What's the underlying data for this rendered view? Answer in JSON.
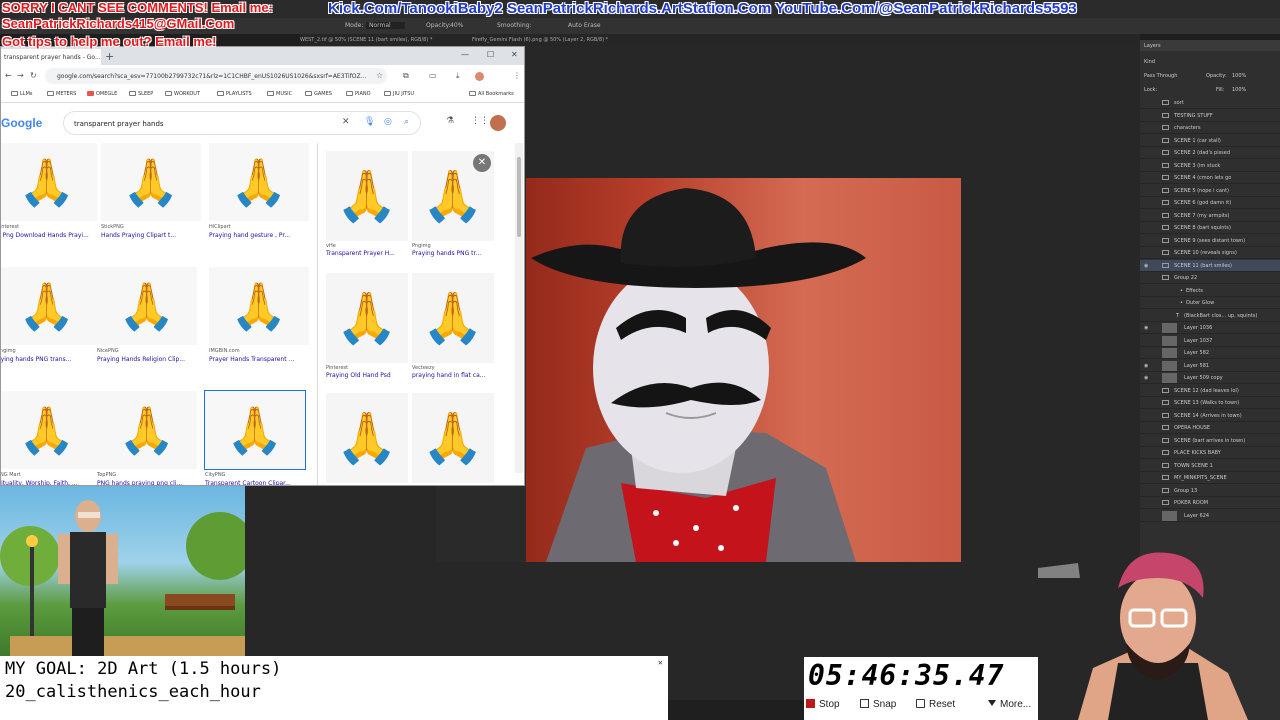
{
  "overlay": {
    "line1_red": "SORRY I CANT SEE COMMENTS! Email me:",
    "kick_link": "Kick.Com/TanookiBaby2",
    "artstation_link": "SeanPatrickRichards.ArtStation.Com",
    "youtube_link": "YouTube.Com/@SeanPatrickRichards5593",
    "email": "SeanPatrickRichards415@GMail.Com",
    "tips": "Got tips to help me out? Email me!"
  },
  "photoshop": {
    "options": {
      "mode_label": "Mode:",
      "mode_value": "Normal",
      "opacity_label": "Opacity:",
      "opacity_value": "40%",
      "smoothing_label": "Smoothing:",
      "auto_erase": "Auto Erase"
    },
    "tabs": [
      "WEST_2.tif @ 50% (SCENE 11 (bart smiles), RGB/8) *",
      "Firefly_Gemini Flash (6).png @ 50% (Layer 2, RGB/8) *"
    ],
    "layers_panel": {
      "title": "Layers",
      "filter_kind": "Kind",
      "blend_mode": "Pass Through",
      "opacity_label": "Opacity:",
      "opacity_value": "100%",
      "lock_label": "Lock:",
      "fill_label": "Fill:",
      "fill_value": "100%",
      "layers": [
        {
          "name": "sort",
          "type": "folder",
          "visible": false
        },
        {
          "name": "TESTING STUFF",
          "type": "folder",
          "visible": false
        },
        {
          "name": "characters",
          "type": "folder",
          "visible": false
        },
        {
          "name": "SCENE 1 (car stall)",
          "type": "folder",
          "visible": false
        },
        {
          "name": "SCENE 2 (dad's pissed",
          "type": "folder",
          "visible": false
        },
        {
          "name": "SCENE 3 (im stuck",
          "type": "folder",
          "visible": false
        },
        {
          "name": "SCENE 4 (cmon lets go",
          "type": "folder",
          "visible": false
        },
        {
          "name": "SCENE 5 (nope i cant)",
          "type": "folder",
          "visible": false
        },
        {
          "name": "SCENE 6 (god damn it)",
          "type": "folder",
          "visible": false
        },
        {
          "name": "SCENE 7 (my armpits)",
          "type": "folder",
          "visible": false
        },
        {
          "name": "SCENE 8 (bart squints)",
          "type": "folder",
          "visible": false
        },
        {
          "name": "SCENE 9 (sees distant town)",
          "type": "folder",
          "visible": false
        },
        {
          "name": "SCENE 10 (reveals signs)",
          "type": "folder",
          "visible": false
        },
        {
          "name": "SCENE 11 (bart smiles)",
          "type": "folder",
          "visible": true,
          "selected": true
        },
        {
          "name": "Group 22",
          "type": "folder",
          "visible": false
        },
        {
          "name": "Effects",
          "type": "fx",
          "visible": false
        },
        {
          "name": "Outer Glow",
          "type": "fx",
          "visible": false
        },
        {
          "name": "(BlackBart clos... up, squints)",
          "type": "text",
          "visible": false
        },
        {
          "name": "Layer 1036",
          "type": "image",
          "visible": true
        },
        {
          "name": "Layer 1037",
          "type": "image",
          "visible": false
        },
        {
          "name": "Layer 582",
          "type": "image",
          "visible": false
        },
        {
          "name": "Layer 581",
          "type": "image",
          "visible": true
        },
        {
          "name": "Layer 509 copy",
          "type": "image",
          "visible": true
        },
        {
          "name": "SCENE 12 (dad leaves lol)",
          "type": "folder",
          "visible": false
        },
        {
          "name": "SCENE 13 (Walks to town)",
          "type": "folder",
          "visible": false
        },
        {
          "name": "SCENE 14 (Arrives in town)",
          "type": "folder",
          "visible": false
        },
        {
          "name": "OPERA HOUSE",
          "type": "folder",
          "visible": false
        },
        {
          "name": "SCENE (bart arrives in town)",
          "type": "folder",
          "visible": false
        },
        {
          "name": "PLACE KICKS BABY",
          "type": "folder",
          "visible": false
        },
        {
          "name": "TOWN SCENE 1",
          "type": "folder",
          "visible": false
        },
        {
          "name": "MY_MINKPITS_SCENE",
          "type": "folder",
          "visible": false
        },
        {
          "name": "Group 13",
          "type": "folder",
          "visible": false
        },
        {
          "name": "POKER ROOM",
          "type": "folder",
          "visible": false
        },
        {
          "name": "Layer 624",
          "type": "image",
          "visible": false
        }
      ]
    }
  },
  "browser": {
    "tab_title": "transparent prayer hands - Go...",
    "url": "google.com/search?sca_esv=77100b2799732c71&rlz=1C1CHBF_enUS1026US1026&sxsrf=AE3TifOZ...",
    "bookmarks": [
      "LLMs",
      "METERS",
      "OMEGLE",
      "SLEEP",
      "WORKOUT",
      "PLAYLISTS",
      "MUSIC",
      "GAMES",
      "PIANO",
      "JIU JITSU"
    ],
    "all_bookmarks": "All Bookmarks",
    "google_logo": "Google",
    "search_query": "transparent prayer hands",
    "results": [
      {
        "source": "Pinterest",
        "title": "e Png Download Hands Prayi..."
      },
      {
        "source": "StickPNG",
        "title": "Hands Praying Clipart t..."
      },
      {
        "source": "HiClipart",
        "title": "Praying hand gesture , Pr..."
      },
      {
        "source": "Pngimg",
        "title": "aying hands PNG trans..."
      },
      {
        "source": "NicePNG",
        "title": "Praying Hands Religion Clip..."
      },
      {
        "source": "IMGBIN.com",
        "title": "Prayer Hands Transparent ..."
      },
      {
        "source": "PNG Mart",
        "title": "irituality, Worship, Faith, ..."
      },
      {
        "source": "TopPNG",
        "title": "PNG hands praying png cli..."
      },
      {
        "source": "CityPNG",
        "title": "Transparent Cartoon Clipar..."
      }
    ],
    "side_results": [
      {
        "source": "vHe",
        "title": "Transparent Prayer H..."
      },
      {
        "source": "Pngimg",
        "title": "Praying hands PNG tr..."
      },
      {
        "source": "Pinterest",
        "title": "Praying Old Hand Psd"
      },
      {
        "source": "Vecteezy",
        "title": "praying hand in flat ca..."
      },
      {
        "source": "",
        "title": ""
      },
      {
        "source": "",
        "title": ""
      }
    ]
  },
  "goal": {
    "line1": "MY GOAL: 2D Art (1.5 hours)",
    "line2": "20_calisthenics_each_hour"
  },
  "timer": {
    "display": "05:46:35.47",
    "stop": "Stop",
    "snap": "Snap",
    "reset": "Reset",
    "more": "More..."
  },
  "colors": {
    "overlay_red": "#e3171c",
    "overlay_blue": "#1f39c9",
    "selected_layer": "#3e4a5a"
  }
}
